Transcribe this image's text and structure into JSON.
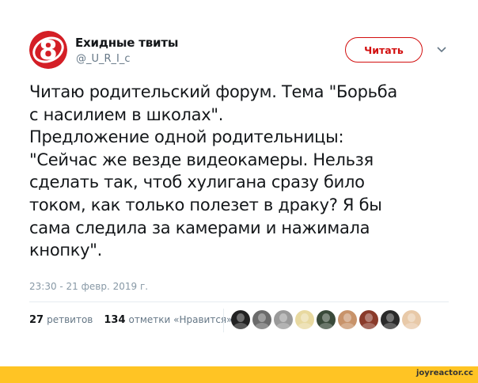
{
  "account": {
    "name": "Ехидные твиты",
    "handle": "@_U_R_I_c",
    "avatar_icon": "channel-8-logo",
    "logo_text": "8"
  },
  "actions": {
    "follow_label": "Читать",
    "menu_icon": "chevron-down-icon"
  },
  "tweet": {
    "lines": [
      "Читаю родительский форум. Тема \"Борьба",
      "с насилием в школах\".",
      "Предложение одной родительницы:",
      "\"Сейчас же везде видеокамеры. Нельзя",
      "сделать так, чтоб хулигана сразу било",
      "током, как только полезет в драку? Я бы",
      "сама следила за камерами и нажимала",
      "кнопку\"."
    ],
    "timestamp": "23:30 - 21 февр. 2019 г."
  },
  "stats": {
    "retweets_count": "27",
    "retweets_label": "ретвитов",
    "likes_count": "134",
    "likes_label": "отметки «Нравится»"
  },
  "liker_avatars": [
    {
      "name": "liker-avatar-1",
      "color": "#222222"
    },
    {
      "name": "liker-avatar-2",
      "color": "#6b6b6b"
    },
    {
      "name": "liker-avatar-3",
      "color": "#9a9a9a"
    },
    {
      "name": "liker-avatar-4",
      "color": "#e8d9a0"
    },
    {
      "name": "liker-avatar-5",
      "color": "#3a4a3a"
    },
    {
      "name": "liker-avatar-6",
      "color": "#c8936a"
    },
    {
      "name": "liker-avatar-7",
      "color": "#8a3a2a"
    },
    {
      "name": "liker-avatar-8",
      "color": "#2a2a2a"
    },
    {
      "name": "liker-avatar-9",
      "color": "#e8c9a8"
    }
  ],
  "footer": {
    "watermark": "joyreactor.cc"
  },
  "colors": {
    "accent": "#d20f0f",
    "text": "#14171a",
    "muted": "#657786",
    "footer_bar": "#ffc424"
  }
}
